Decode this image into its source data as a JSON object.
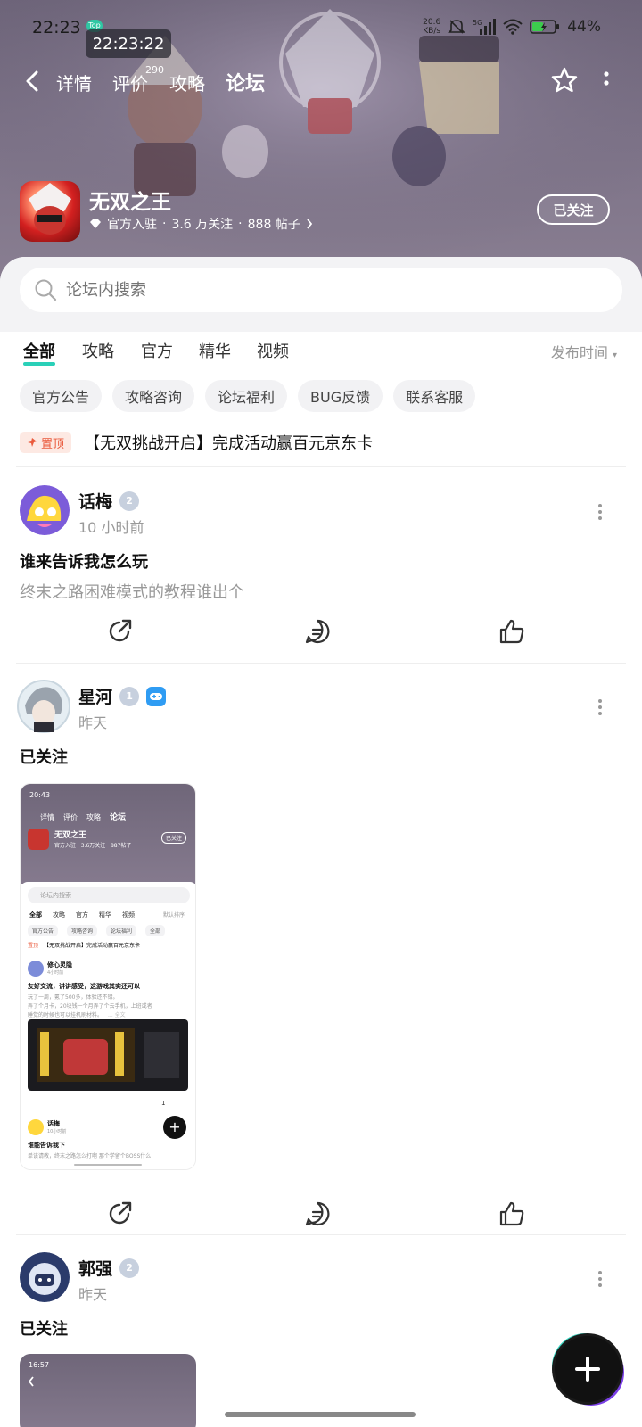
{
  "status_bar": {
    "time": "22:23",
    "overlay_clock": "22:23:22",
    "overlay_badge": "Top",
    "net_speed": "20.6",
    "net_unit": "KB/s",
    "battery": "44%"
  },
  "nav": {
    "tabs": [
      {
        "label": "详情"
      },
      {
        "label": "评价"
      },
      {
        "label": "攻略"
      },
      {
        "label": "论坛"
      }
    ],
    "review_count": "290"
  },
  "app": {
    "name": "无双之王",
    "official": "官方入驻",
    "followers": "3.6 万关注",
    "posts": "888 帖子",
    "follow_label": "已关注"
  },
  "search": {
    "placeholder": "论坛内搜索"
  },
  "filter_tabs": [
    "全部",
    "攻略",
    "官方",
    "精华",
    "视频"
  ],
  "sort_label": "发布时间",
  "chips": [
    "官方公告",
    "攻略咨询",
    "论坛福利",
    "BUG反馈",
    "联系客服"
  ],
  "pinned": {
    "badge": "置顶",
    "title": "【无双挑战开启】完成活动赢百元京东卡"
  },
  "posts": [
    {
      "user": "话梅",
      "time": "10 小时前",
      "title": "谁来告诉我怎么玩",
      "body": "终末之路困难模式的教程谁出个"
    },
    {
      "user": "星河",
      "time": "昨天",
      "title": "已关注",
      "thumb": {
        "time": "20:43",
        "nav": [
          "详情",
          "评价",
          "攻略",
          "论坛"
        ],
        "app_name": "无双之王",
        "app_meta": "官方入驻 · 3.6万关注 · 887帖子",
        "follow": "已关注",
        "search": "论坛内搜索",
        "tabs": [
          "全部",
          "攻略",
          "官方",
          "精华",
          "视频"
        ],
        "sort": "默认排序",
        "chips": [
          "官方公告",
          "攻略咨询",
          "论坛福利",
          "全部"
        ],
        "pinned_tag": "置顶",
        "pinned": "【无双挑战开启】完成活动赢百元京东卡",
        "p1_user": "修心灵隐",
        "p1_time": "4小时前",
        "p1_title": "友好交流，讲讲感受，这游戏其实还可以",
        "p1_body": "玩了一周，氪了500多，体验还不错。",
        "p1_body2": "弄了个月卡，20块钱一个月弄了个云手机，上班或者",
        "p1_body3": "睡觉的时候也可以挂机刷材料。",
        "p1_more": "... 全文",
        "p1_likes": "1",
        "p2_user": "话梅",
        "p2_time": "10小时前",
        "p2_title": "谁能告诉我下",
        "p2_body": "单该请教，终末之路怎么打啊 那个学留个BOSS什么"
      }
    },
    {
      "user": "郭强",
      "time": "昨天",
      "title": "已关注",
      "thumb_time": "16:57"
    }
  ]
}
